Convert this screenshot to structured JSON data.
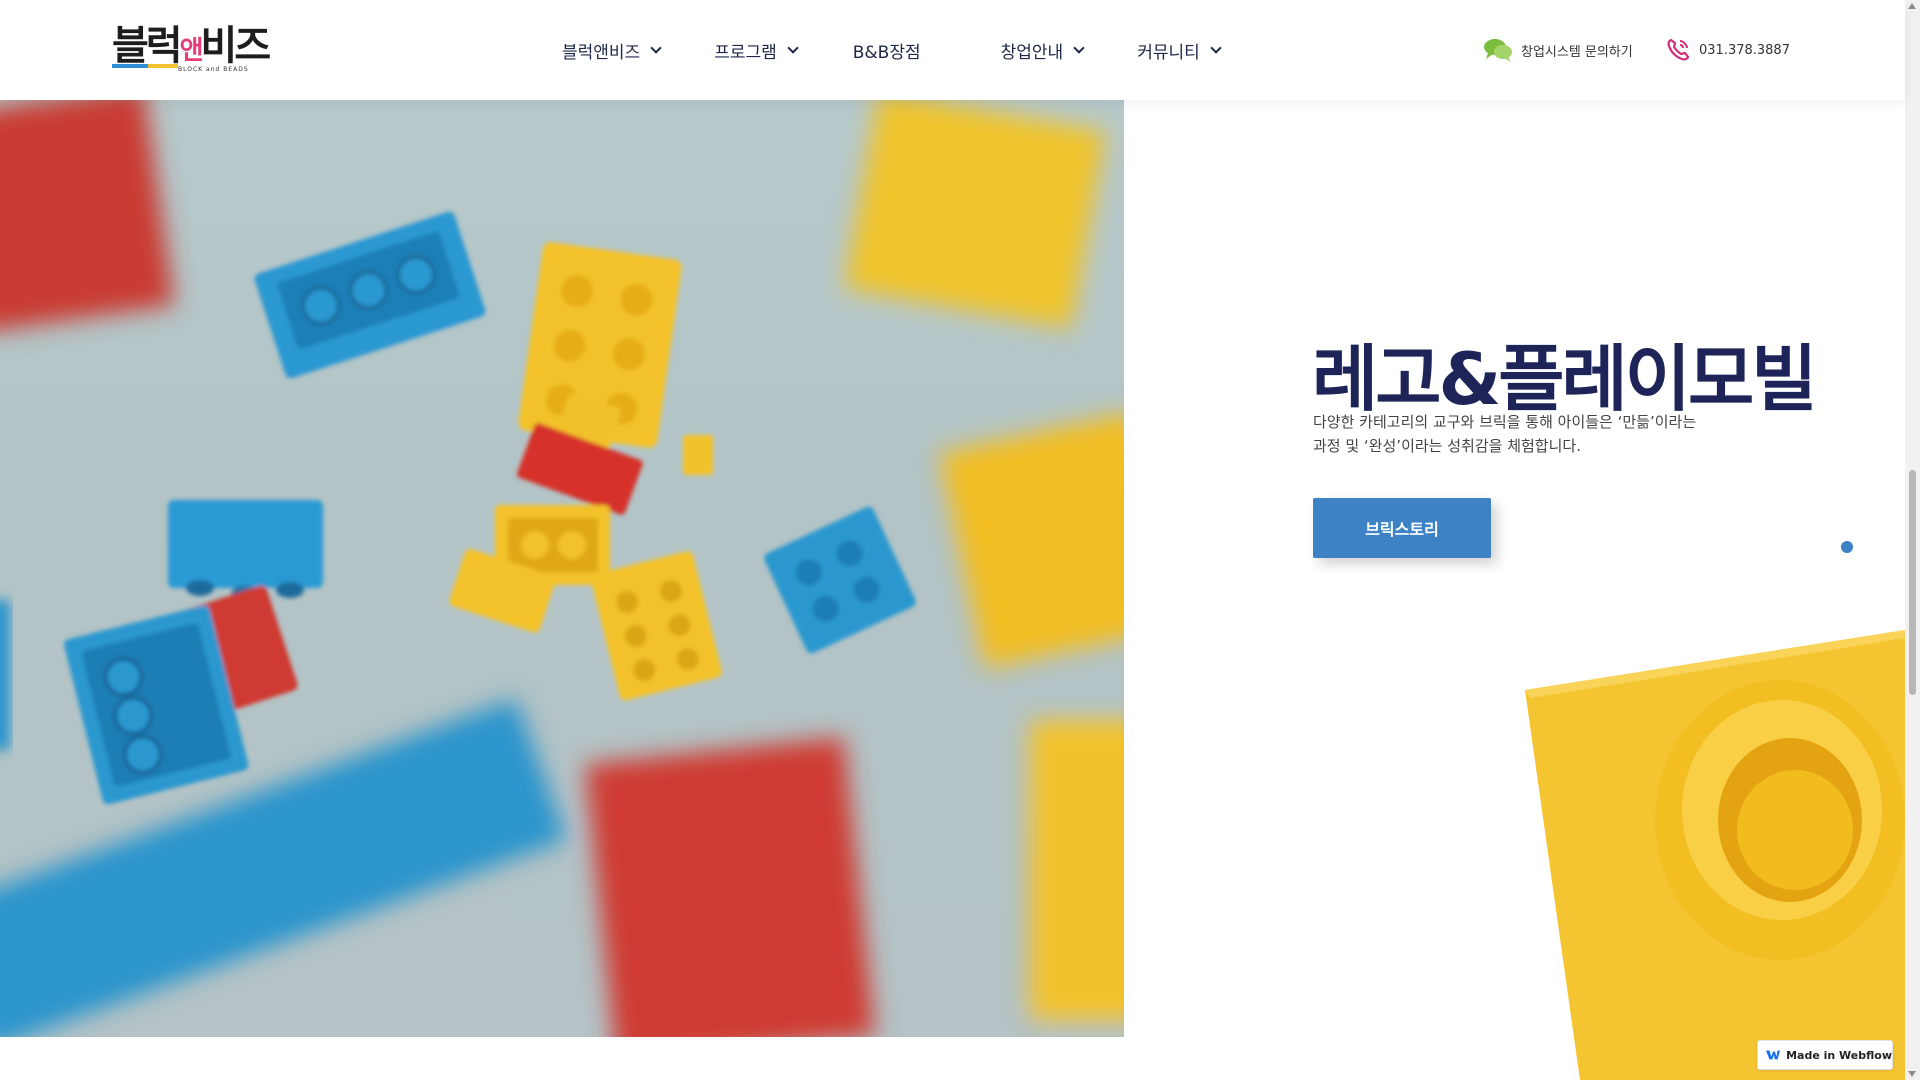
{
  "brand": {
    "logo_text_a": "블럭",
    "logo_text_b": "앤",
    "logo_text_c": "비즈",
    "logo_sub": "BLOCK and BEADS"
  },
  "nav": {
    "items": [
      {
        "label": "블럭앤비즈",
        "has_dropdown": true
      },
      {
        "label": "프로그램",
        "has_dropdown": true
      },
      {
        "label": "B&B장점",
        "has_dropdown": false
      },
      {
        "label": "창업안내",
        "has_dropdown": true
      },
      {
        "label": "커뮤니티",
        "has_dropdown": true
      }
    ]
  },
  "contact": {
    "inquiry_label": "창업시스템 문의하기",
    "phone": "031.378.3887",
    "chat_icon": "chat-bubble-icon",
    "phone_icon": "phone-icon"
  },
  "hero": {
    "title": "레고&플레이모빌",
    "desc_line1": "다양한 카테고리의 교구와 브릭을 통해 아이들은 ‘만듦’이라는",
    "desc_line2": "과정 및 ‘완성’이라는 성취감을 체험합니다.",
    "cta_label": "브릭스토리"
  },
  "badge": {
    "label": "Made in Webflow"
  },
  "colors": {
    "navy": "#1e2458",
    "accent_blue": "#3c82c4",
    "brick_yellow": "#f5c531",
    "brick_red": "#d9332f",
    "brick_blue": "#2a9ad4",
    "chat_green": "#7bbd3e",
    "phone_pink": "#d42e7a"
  }
}
